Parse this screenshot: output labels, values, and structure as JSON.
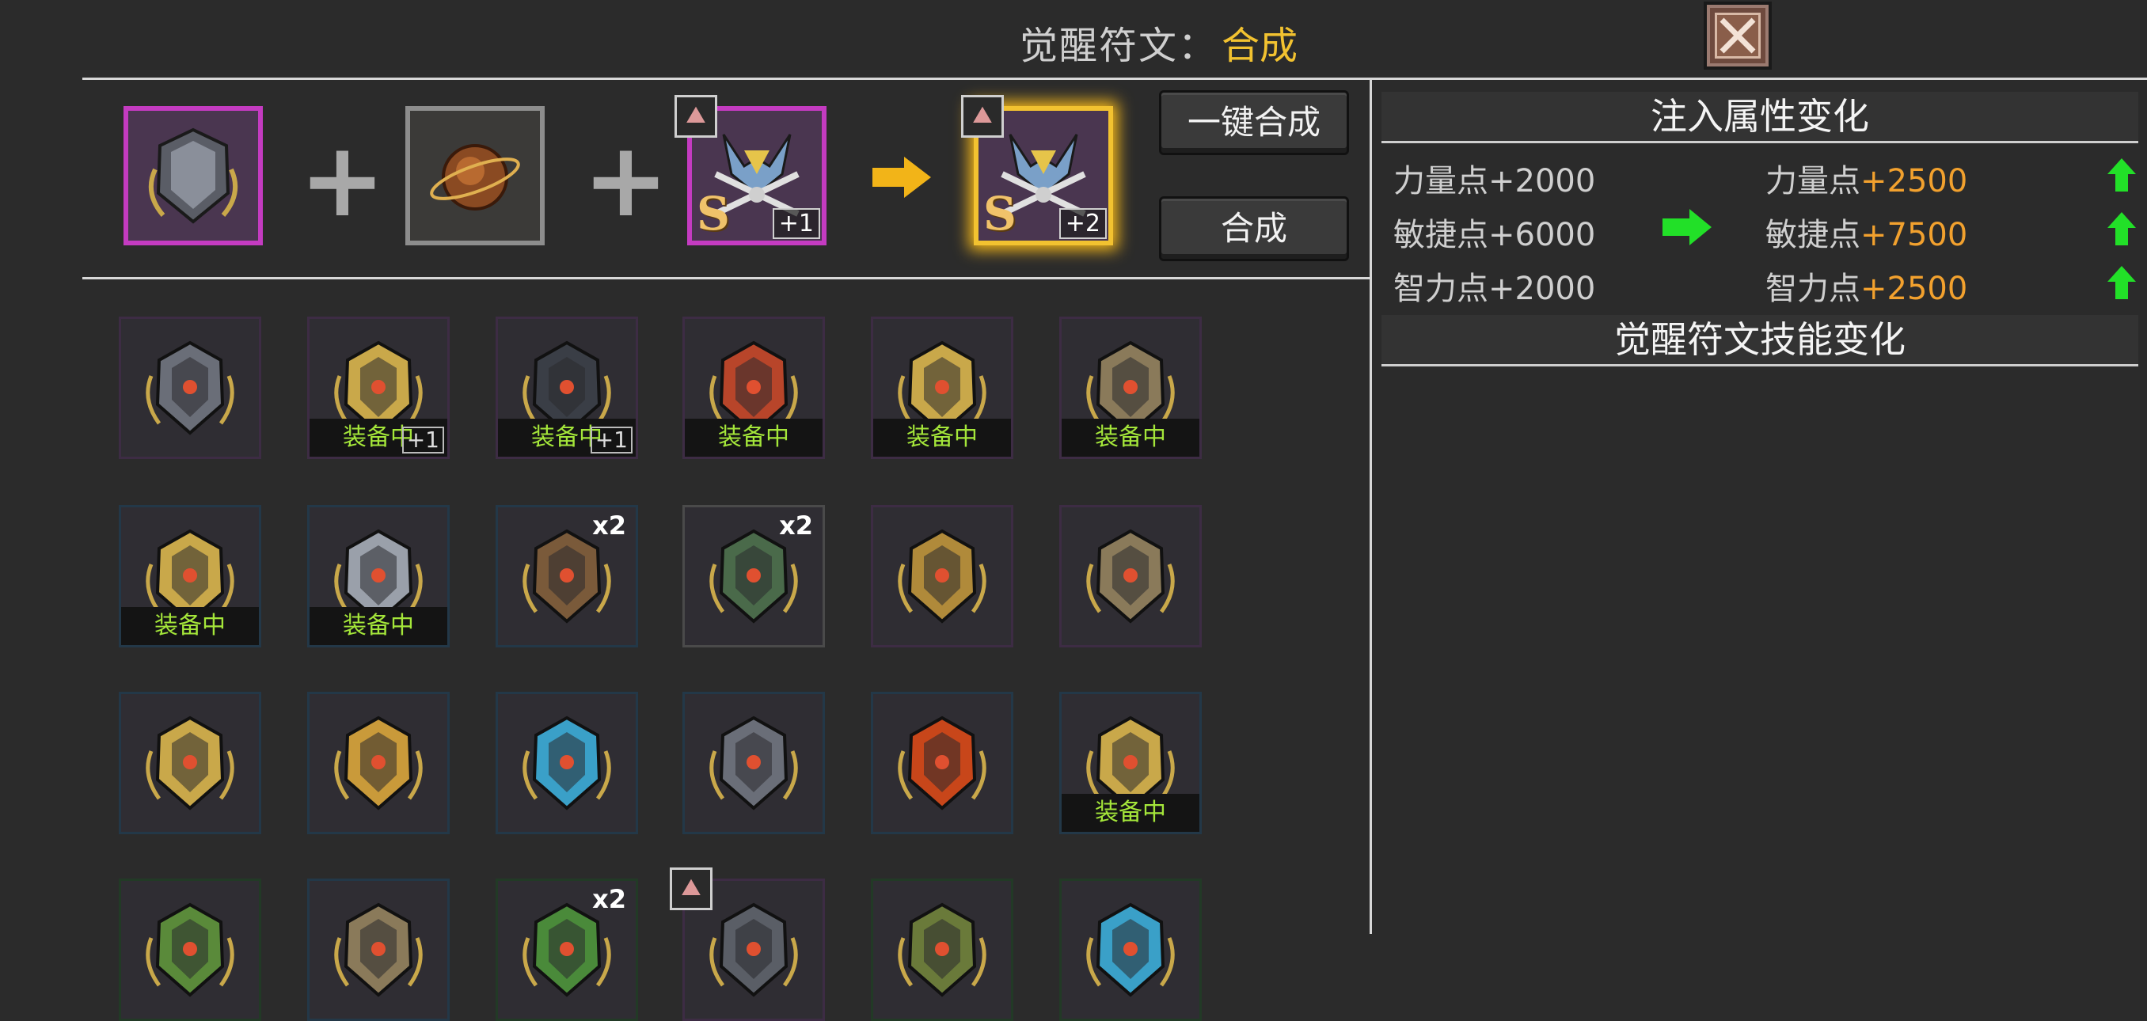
{
  "header": {
    "label": "觉醒符文：",
    "mode": "合成"
  },
  "compose": {
    "input1": {
      "name": "rune-shield"
    },
    "input2": {
      "name": "rune-orb"
    },
    "input3": {
      "grade": "S",
      "level": "+1"
    },
    "result": {
      "grade": "S",
      "level": "+2"
    }
  },
  "buttons": {
    "one_key": "一键合成",
    "compose": "合成"
  },
  "panel": {
    "attr_title": "注入属性变化",
    "skill_title": "觉醒符文技能变化",
    "stats": [
      {
        "before_label": "力量点",
        "before_value": "+2000",
        "after_label": "力量点",
        "after_value": "+2500"
      },
      {
        "before_label": "敏捷点",
        "before_value": "+6000",
        "after_label": "敏捷点",
        "after_value": "+7500"
      },
      {
        "before_label": "智力点",
        "before_value": "+2000",
        "after_label": "智力点",
        "after_value": "+2500"
      }
    ]
  },
  "grid": {
    "equip_label": "装备中",
    "plus1_label": "+1",
    "x2_label": "x2",
    "colors": {
      "purple": "#c43bc1",
      "blue": "#3b90c4",
      "green": "#3fae4a",
      "gold": "#f2c230",
      "equip_text": "#a4e63a"
    }
  }
}
